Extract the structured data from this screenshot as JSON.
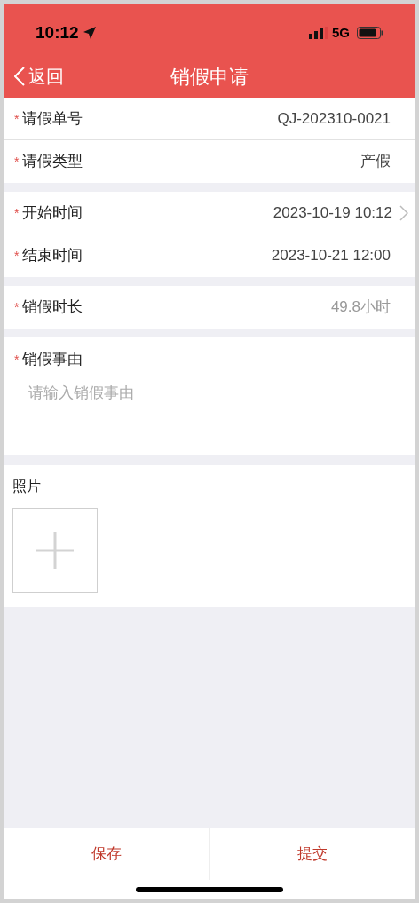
{
  "status_bar": {
    "time": "10:12",
    "network": "5G"
  },
  "nav": {
    "back": "返回",
    "title": "销假申请"
  },
  "groups": [
    {
      "rows": [
        {
          "label": "请假单号",
          "mark": "*",
          "value": "QJ-202310-0021",
          "chevron": false,
          "muted": false
        },
        {
          "label": "请假类型",
          "mark": "*",
          "value": "产假",
          "chevron": false,
          "muted": false
        }
      ]
    },
    {
      "rows": [
        {
          "label": "开始时间",
          "mark": "*",
          "value": "2023-10-19 10:12",
          "chevron": true,
          "muted": false
        },
        {
          "label": "结束时间",
          "mark": "*",
          "value": "2023-10-21 12:00",
          "chevron": false,
          "muted": false
        }
      ]
    },
    {
      "rows": [
        {
          "label": "销假时长",
          "mark": "*",
          "value": "49.8小时",
          "chevron": false,
          "muted": true
        }
      ]
    }
  ],
  "reason": {
    "label": "销假事由",
    "mark": "*",
    "placeholder": "请输入销假事由"
  },
  "photos": {
    "label": "照片"
  },
  "buttons": [
    "保存",
    "提交"
  ]
}
